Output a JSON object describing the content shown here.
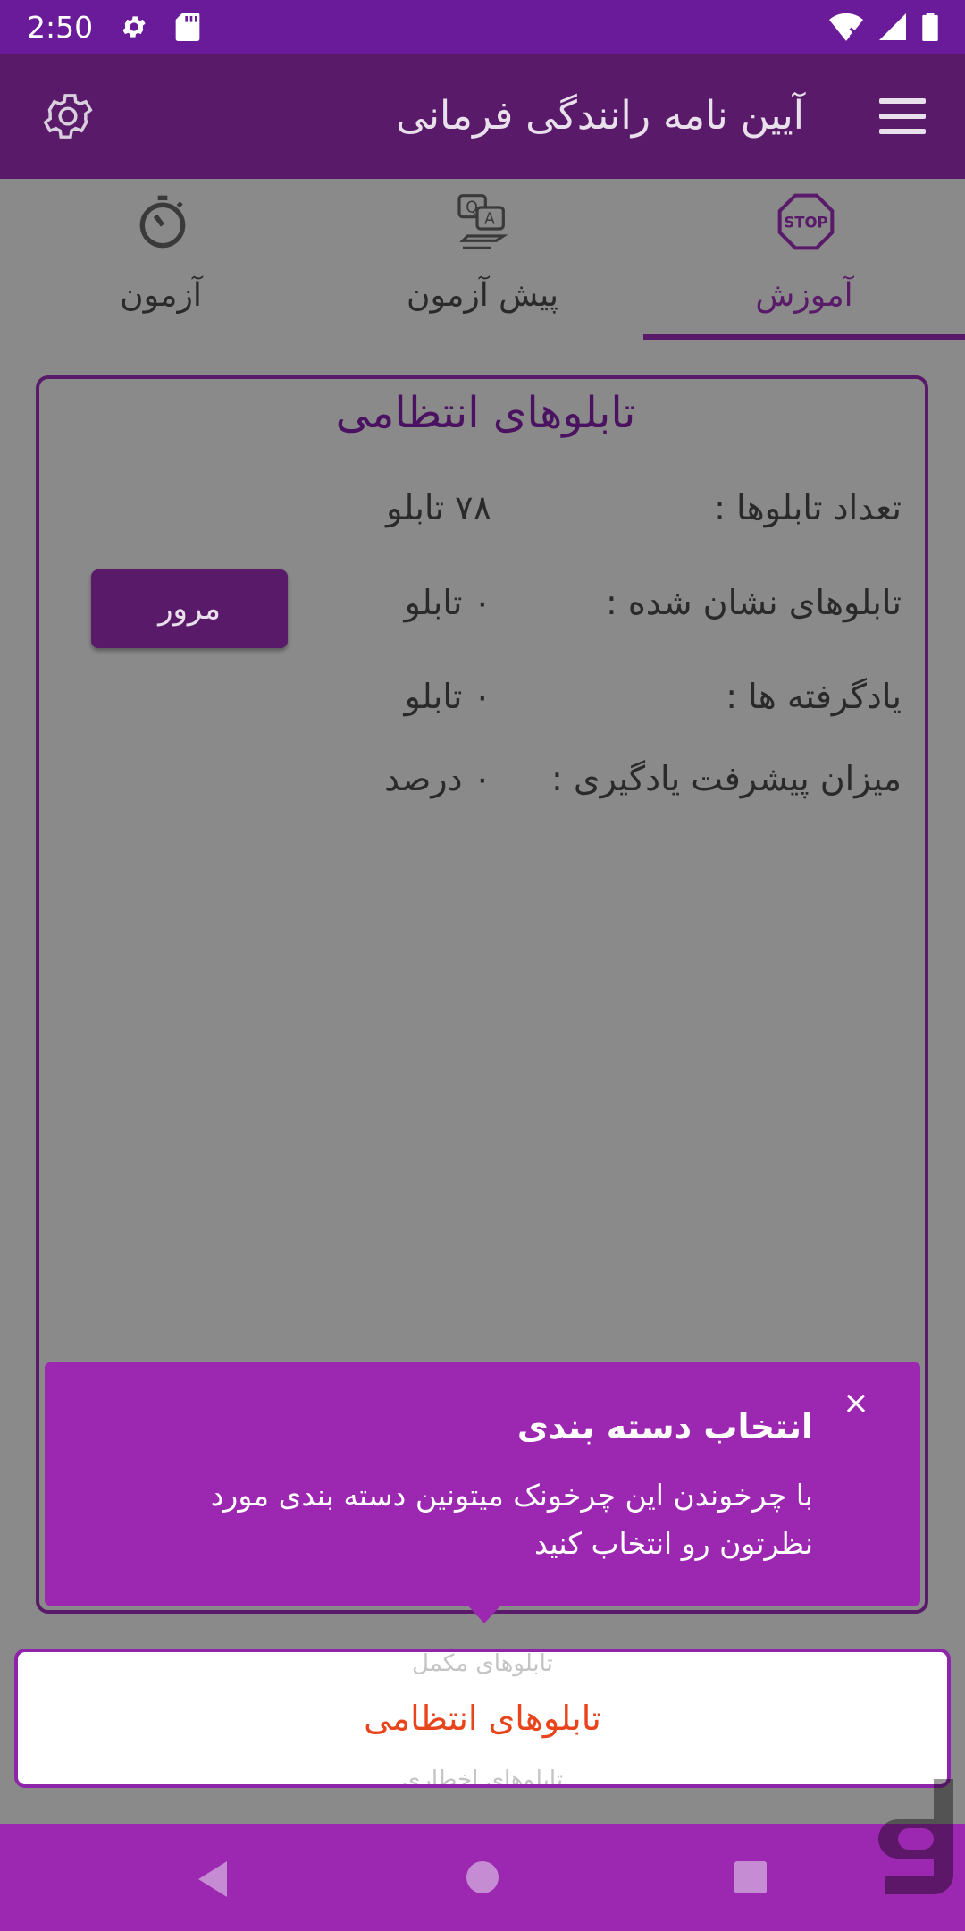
{
  "status_bar": {
    "time": "2:50",
    "icons": [
      "settings-icon",
      "sd-card-icon",
      "wifi-icon",
      "signal-icon",
      "battery-icon"
    ]
  },
  "app_bar": {
    "title": "آیین نامه رانندگی فرمانی",
    "icons": [
      "gear-icon",
      "hamburger-menu-icon"
    ]
  },
  "tabs": [
    {
      "label": "آموزش",
      "icon": "stop-sign-icon",
      "active": true
    },
    {
      "label": "پیش آزمون",
      "icon": "qa-icon",
      "active": false
    },
    {
      "label": "آزمون",
      "icon": "stopwatch-icon",
      "active": false
    }
  ],
  "card": {
    "title": "تابلوهای انتظامی",
    "rows": [
      {
        "label": "تعداد تابلوها :",
        "value": "۷۸ تابلو"
      },
      {
        "label": "تابلوهای نشان شده :",
        "value": "۰ تابلو"
      },
      {
        "label": "یادگرفته ها :",
        "value": "۰ تابلو"
      },
      {
        "label": "میزان پیشرفت یادگیری :",
        "value": "۰ درصد"
      }
    ],
    "review_button": "مرور"
  },
  "tooltip": {
    "title": "انتخاب دسته بندی",
    "body": "با چرخوندن این چرخونک میتونین دسته بندی مورد نظرتون رو انتخاب کنید",
    "close": "×"
  },
  "spinner": {
    "prev": "تابلوهای مکمل",
    "current": "تابلوهای انتظامی",
    "next": "تابلوهای اخطاری"
  },
  "colors": {
    "status_bar": "#6a1b9a",
    "app_bar": "#5a1a6a",
    "accent": "#9c27b0",
    "selected_text": "#e8451c"
  }
}
